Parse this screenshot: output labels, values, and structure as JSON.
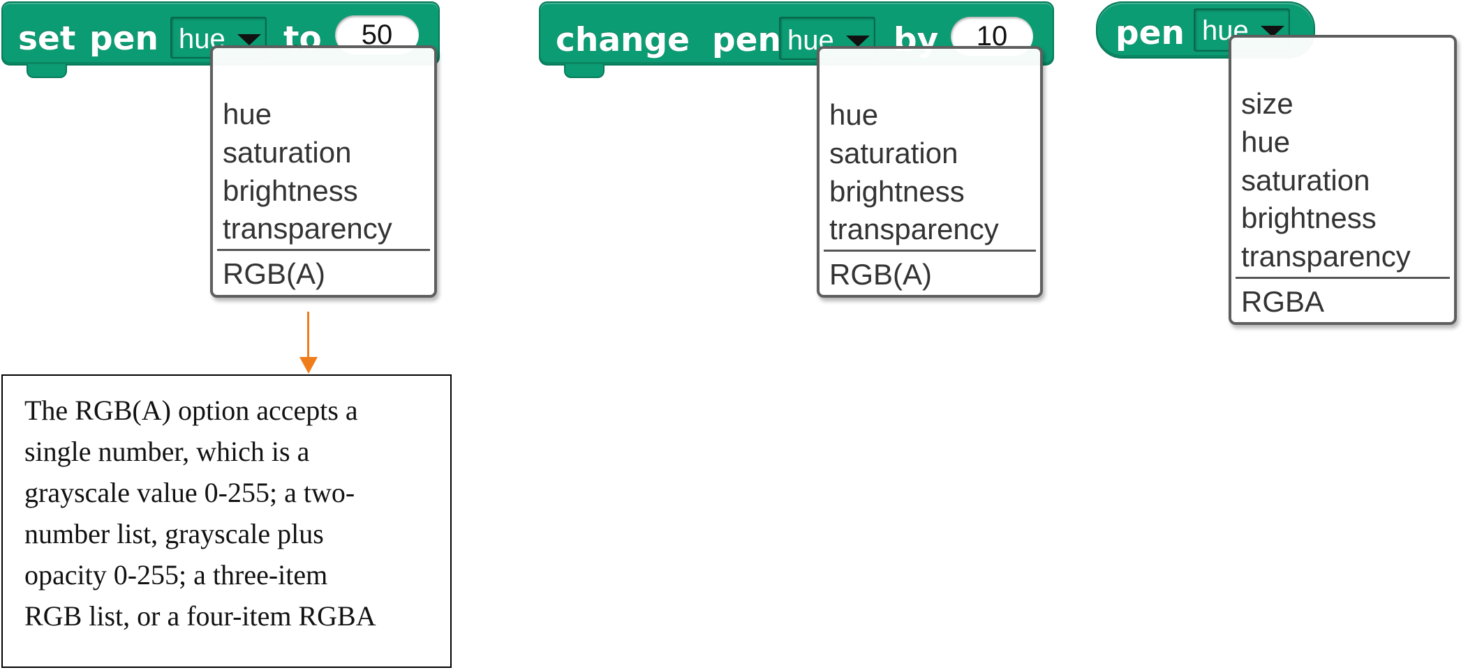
{
  "set_pen_block": {
    "label_set": "set",
    "label_pen": "pen",
    "dropdown_value": "hue",
    "label_to": "to",
    "value": "50",
    "menu_items": [
      "hue",
      "saturation",
      "brightness",
      "transparency"
    ],
    "menu_extra": "RGB(A)"
  },
  "change_pen_block": {
    "label_change": "change",
    "label_pen": "pen",
    "dropdown_value": "hue",
    "label_by": "by",
    "value": "10",
    "menu_items": [
      "hue",
      "saturation",
      "brightness",
      "transparency"
    ],
    "menu_extra": "RGB(A)"
  },
  "pen_reporter": {
    "label_pen": "pen",
    "dropdown_value": "hue",
    "menu_items": [
      "size",
      "hue",
      "saturation",
      "brightness",
      "transparency"
    ],
    "menu_extra": "RGBA"
  },
  "annotation": {
    "text": "The RGB(A) option accepts a single number, which is a grayscale value 0-255; a two-number list, grayscale plus opacity 0-255; a three-item RGB list, or a four-item RGBA",
    "lines": [
      "The RGB(A) option accepts a",
      "single number, which is a",
      "grayscale value 0-255; a two-",
      "number list, grayscale plus",
      "opacity 0-255; a three-item",
      "RGB list, or a four-item RGBA"
    ]
  },
  "colors": {
    "block_green": "#0c9c73",
    "block_border": "#067a59",
    "arrow_orange": "#ef7d1a"
  }
}
